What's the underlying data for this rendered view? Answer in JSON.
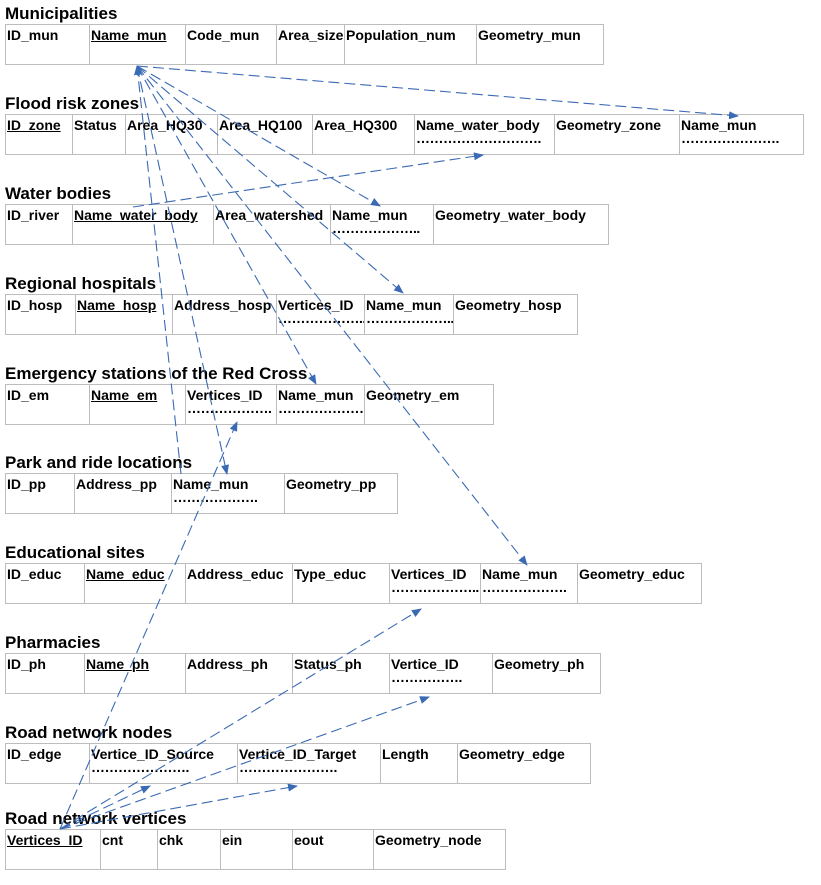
{
  "tables": [
    {
      "id": "municipalities",
      "title": "Municipalities",
      "fields": [
        {
          "label": "ID_mun"
        },
        {
          "label": "Name_mun",
          "key": true
        },
        {
          "label": "Code_mun"
        },
        {
          "label": "Area_size"
        },
        {
          "label": "Population_num"
        },
        {
          "label": "Geometry_mun"
        }
      ]
    },
    {
      "id": "flood-risk-zones",
      "title": "Flood risk zones",
      "fields": [
        {
          "label": "ID_zone",
          "key": true
        },
        {
          "label": "Status"
        },
        {
          "label": "Area_HQ30"
        },
        {
          "label": "Area_HQ100"
        },
        {
          "label": "Area_HQ300"
        },
        {
          "label": "Name_water_body",
          "dots": "………………………."
        },
        {
          "label": "Geometry_zone"
        },
        {
          "label": "Name_mun",
          "dots": "…………………."
        }
      ]
    },
    {
      "id": "water-bodies",
      "title": "Water bodies",
      "fields": [
        {
          "label": "ID_river"
        },
        {
          "label": "Name_water_body",
          "key": true
        },
        {
          "label": "Area_watershed"
        },
        {
          "label": "Name_mun",
          "dots": "……………….."
        },
        {
          "label": "Geometry_water_body"
        }
      ]
    },
    {
      "id": "regional-hospitals",
      "title": "Regional hospitals",
      "fields": [
        {
          "label": "ID_hosp"
        },
        {
          "label": "Name_hosp",
          "key": true
        },
        {
          "label": "Address_hosp"
        },
        {
          "label": "Vertices_ID",
          "dots": "……………….."
        },
        {
          "label": "Name_mun",
          "dots": "……………….."
        },
        {
          "label": "Geometry_hosp"
        }
      ]
    },
    {
      "id": "emergency-stations",
      "title": "Emergency stations of the Red Cross",
      "fields": [
        {
          "label": "ID_em"
        },
        {
          "label": "Name_em",
          "key": true
        },
        {
          "label": "Vertices_ID",
          "dots": "………………."
        },
        {
          "label": "Name_mun",
          "dots": "…………………"
        },
        {
          "label": "Geometry_em"
        }
      ]
    },
    {
      "id": "park-and-ride",
      "title": "Park and ride locations",
      "fields": [
        {
          "label": "ID_pp"
        },
        {
          "label": "Address_pp"
        },
        {
          "label": "Name_mun",
          "dots": "………………."
        },
        {
          "label": "Geometry_pp"
        }
      ]
    },
    {
      "id": "educational-sites",
      "title": "Educational sites",
      "fields": [
        {
          "label": "ID_educ"
        },
        {
          "label": "Name_educ",
          "key": true
        },
        {
          "label": "Address_educ"
        },
        {
          "label": "Type_educ"
        },
        {
          "label": "Vertices_ID",
          "dots": "……………….."
        },
        {
          "label": "Name_mun",
          "dots": "………………."
        },
        {
          "label": "Geometry_educ"
        }
      ]
    },
    {
      "id": "pharmacies",
      "title": "Pharmacies",
      "fields": [
        {
          "label": "ID_ph"
        },
        {
          "label": "Name_ph",
          "key": true
        },
        {
          "label": "Address_ph"
        },
        {
          "label": "Status_ph"
        },
        {
          "label": "Vertice_ID",
          "dots": "……………."
        },
        {
          "label": "Geometry_ph"
        }
      ]
    },
    {
      "id": "road-network-nodes",
      "title": "Road network nodes",
      "fields": [
        {
          "label": "ID_edge"
        },
        {
          "label": "Vertice_ID_Source",
          "dots": "…………………."
        },
        {
          "label": "Vertice_ID_Target",
          "dots": "…………………."
        },
        {
          "label": "Length"
        },
        {
          "label": "Geometry_edge"
        }
      ]
    },
    {
      "id": "road-network-vertices",
      "title": "Road network vertices",
      "fields": [
        {
          "label": "Vertices_ID",
          "key": true
        },
        {
          "label": "cnt"
        },
        {
          "label": "chk"
        },
        {
          "label": "ein"
        },
        {
          "label": "eout"
        },
        {
          "label": "Geometry_node"
        }
      ]
    }
  ],
  "colors": {
    "arrow": "#3a6ab3",
    "border": "#bdbdbd"
  }
}
